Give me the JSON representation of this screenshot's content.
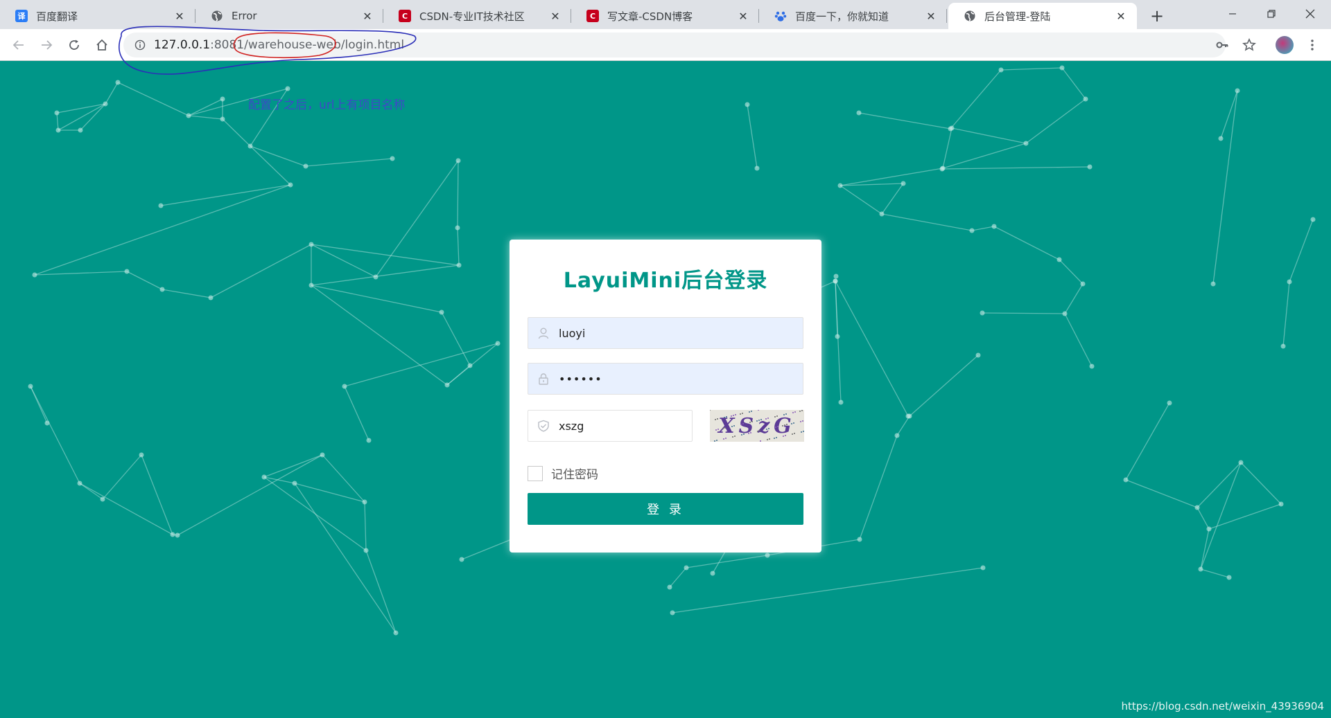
{
  "browser": {
    "tabs": [
      {
        "title": "百度翻译",
        "icon": "translate-icon"
      },
      {
        "title": "Error",
        "icon": "globe-icon"
      },
      {
        "title": "CSDN-专业IT技术社区",
        "icon": "csdn-icon"
      },
      {
        "title": "写文章-CSDN博客",
        "icon": "csdn-icon"
      },
      {
        "title": "百度一下，你就知道",
        "icon": "baidu-paw-icon"
      },
      {
        "title": "后台管理-登陆",
        "icon": "globe-icon",
        "active": true
      }
    ],
    "favicon_labels": {
      "translate": "译",
      "csdn": "C"
    },
    "url": {
      "host": "127.0.0.1",
      "port": ":8081",
      "path": "/warehouse-web/login.html"
    }
  },
  "annotation": "配置了之后，url上有项目名称",
  "login": {
    "title": "LayuiMini后台登录",
    "username_value": "luoyi",
    "password_value": "••••••",
    "captcha_value": "xszg",
    "captcha_image_text": "XSzG",
    "remember_label": "记住密码",
    "submit_label": "登 录"
  },
  "watermark": "https://blog.csdn.net/weixin_43936904",
  "colors": {
    "accent": "#009688",
    "annotation": "#3e48c8",
    "annotation_circle_url": "#2b2fb8",
    "annotation_circle_path": "#d0201f"
  }
}
